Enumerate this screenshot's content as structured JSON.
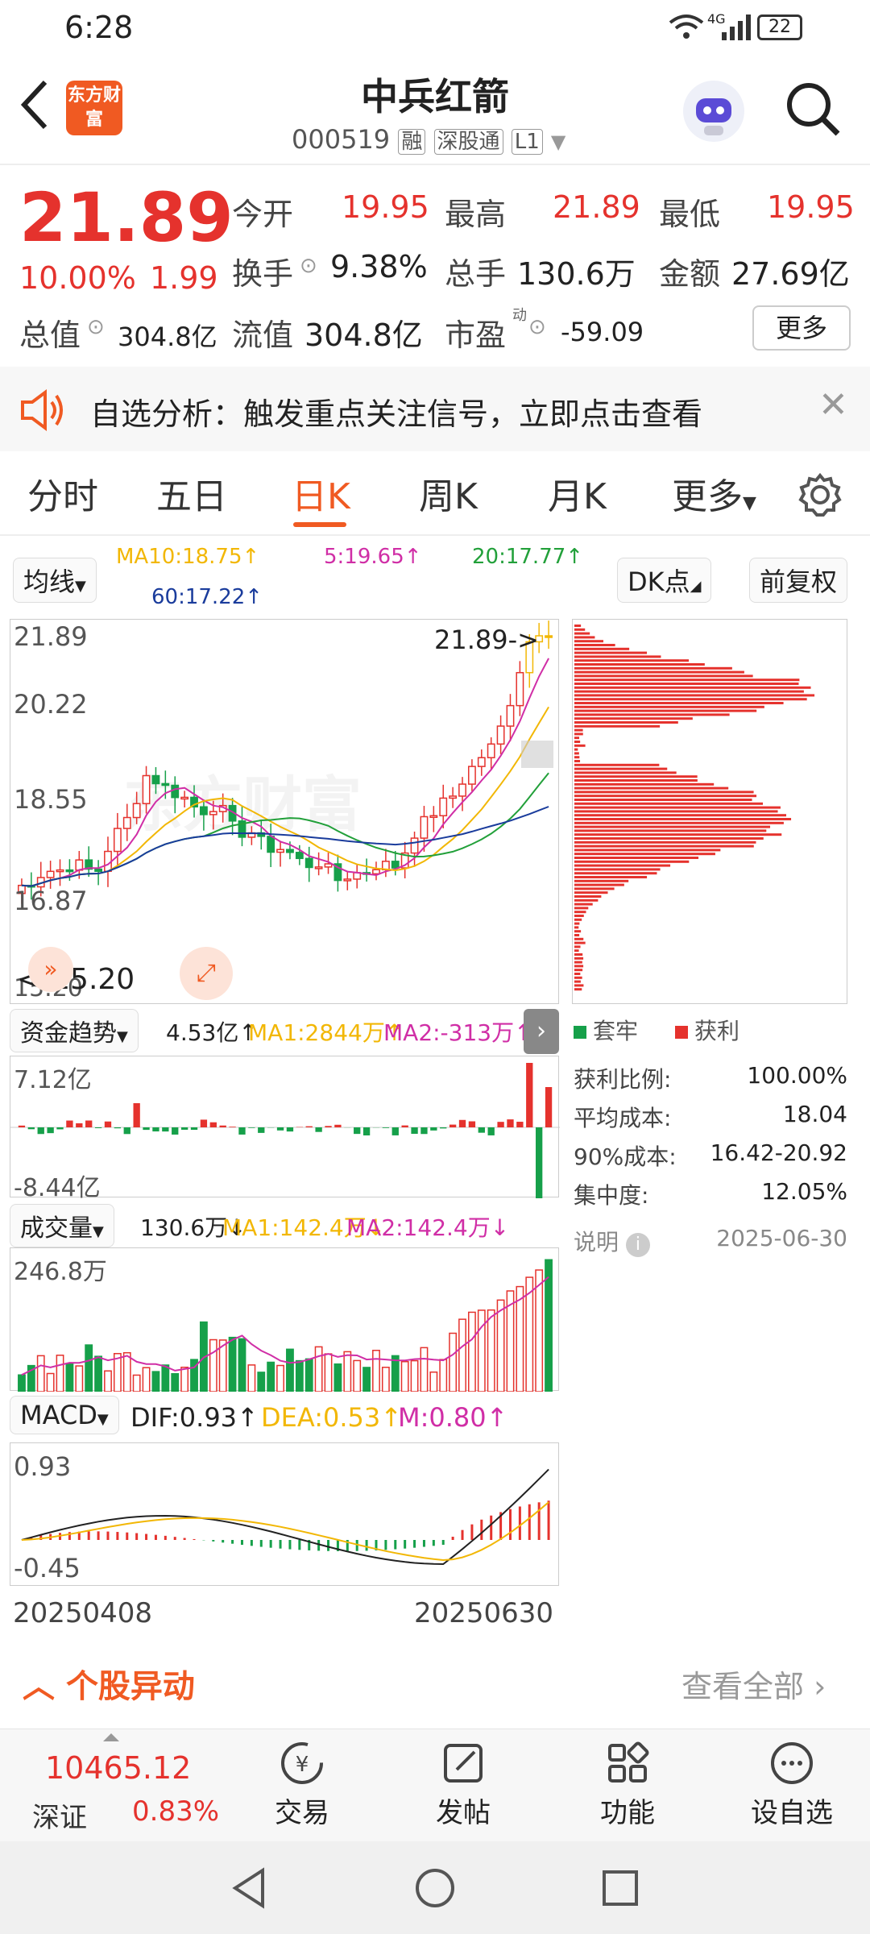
{
  "status_bar": {
    "time": "6:28",
    "network": "4G",
    "battery": "22"
  },
  "header": {
    "logo_text": "东方财富",
    "title": "中兵红箭",
    "code": "000519",
    "badge_1": "融",
    "badge_2": "深股通",
    "badge_3": "L1"
  },
  "quote": {
    "price": "21.89",
    "change_pct": "10.00%",
    "change": "1.99",
    "open_label": "今开",
    "open": "19.95",
    "high_label": "最高",
    "high": "21.89",
    "low_label": "最低",
    "low": "19.95",
    "turnover_label": "换手",
    "turnover": "9.38%",
    "volume_label": "总手",
    "volume": "130.6万",
    "amount_label": "金额",
    "amount": "27.69亿",
    "mktcap_label": "总值",
    "mktcap": "304.8亿",
    "float_label": "流值",
    "float": "304.8亿",
    "pe_label": "市盈",
    "pe_sup": "动",
    "pe": "-59.09",
    "more_label": "更多"
  },
  "banner": {
    "text": "自选分析：触发重点关注信号，立即点击查看"
  },
  "tabs": [
    "分时",
    "五日",
    "日K",
    "周K",
    "月K",
    "更多"
  ],
  "ma_bar": {
    "dropdown": "均线",
    "ma10": "MA10:18.75↑",
    "ma5": "5:19.65↑",
    "ma20": "20:17.77↑",
    "ma60": "60:17.22↑",
    "dk": "DK点",
    "fq": "前复权"
  },
  "kline": {
    "y_top": "21.89",
    "y_2": "20.22",
    "y_3": "18.55",
    "y_4": "16.87",
    "y_bottom": "15.20",
    "last_tag": "21.89->",
    "low_tag": "<-15.20",
    "watermark": "东方财富"
  },
  "fund_flow": {
    "dropdown": "资金趋势",
    "value": "4.53亿↑",
    "ma1": "MA1:2844万↑",
    "ma2": "MA2:-313万↑",
    "y_top": "7.12亿",
    "y_bottom": "-8.44亿"
  },
  "volume": {
    "dropdown": "成交量",
    "value": "130.6万↓",
    "ma1": "MA1:142.4万↓",
    "ma2": "MA2:142.4万↓",
    "y_top": "246.8万"
  },
  "macd": {
    "dropdown": "MACD",
    "dif": "DIF:0.93↑",
    "dea": "DEA:0.53↑",
    "m": "M:0.80↑",
    "y_top": "0.93",
    "y_bottom": "-0.45"
  },
  "dates": {
    "start": "20250408",
    "end": "20250630"
  },
  "chip": {
    "legend_trapped": "套牢",
    "legend_profit": "获利",
    "rows": [
      {
        "label": "获利比例:",
        "value": "100.00%"
      },
      {
        "label": "平均成本:",
        "value": "18.04"
      },
      {
        "label": "90%成本:",
        "value": "16.42-20.92"
      },
      {
        "label": "集中度:",
        "value": "12.05%"
      }
    ],
    "note_label": "说明",
    "note_date": "2025-06-30"
  },
  "alerts": {
    "title": "个股异动",
    "view_all": "查看全部"
  },
  "bottom_nav": {
    "index_value": "10465.12",
    "index_name": "深证",
    "index_pct": "0.83%",
    "trade": "交易",
    "post": "发帖",
    "func": "功能",
    "watch": "设自选"
  },
  "colors": {
    "accent": "#f05a22",
    "up": "#e5322d",
    "down": "#16a04a",
    "ma5": "#d02ea6",
    "ma10": "#f2b705",
    "ma20": "#22a03a",
    "ma60": "#1a3c9c"
  }
}
